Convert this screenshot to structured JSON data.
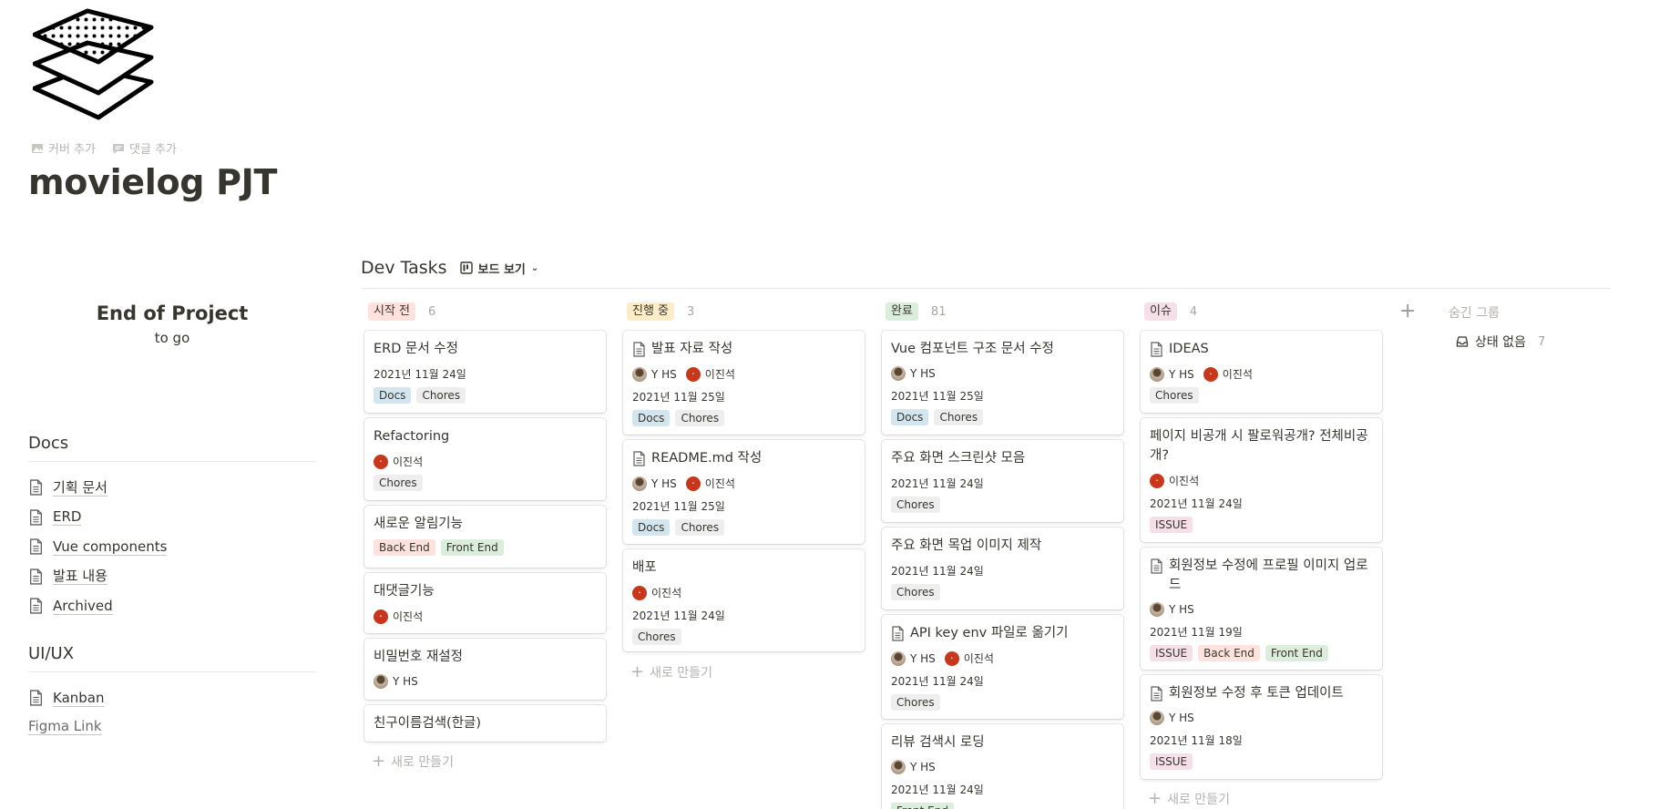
{
  "page": {
    "title": "movielog PJT",
    "actions": {
      "add_cover": "커버 추가",
      "add_comment": "댓글 추가"
    },
    "icon": "stack-layers-icon"
  },
  "countdown": {
    "title": "End of Project",
    "subtitle": "to go"
  },
  "sidebar": {
    "docs_heading": "Docs",
    "docs_links": [
      "기획 문서",
      "ERD",
      "Vue components",
      "발표 내용",
      "Archived"
    ],
    "uiux_heading": "UI/UX",
    "uiux_links": [
      "Kanban"
    ],
    "figma_link": "Figma Link"
  },
  "board": {
    "title": "Dev Tasks",
    "view_label": "보드 보기",
    "new_label": "새로 만들기",
    "hidden_groups_label": "숨긴 그룹",
    "no_status": {
      "label": "상태 없음",
      "count": "7"
    },
    "columns": [
      {
        "status": "시작 전",
        "count": "6",
        "pill_bg": "#ffe2dd",
        "cards": [
          {
            "title": "ERD 문서 수정",
            "date": "2021년 11월 24일",
            "tags": [
              "Docs",
              "Chores"
            ]
          },
          {
            "title": "Refactoring",
            "people": [
              "이진석"
            ],
            "tags": [
              "Chores"
            ]
          },
          {
            "title": "새로운 알림기능",
            "tags": [
              "Back End",
              "Front End"
            ]
          },
          {
            "title": "대댓글기능",
            "people": [
              "이진석"
            ]
          },
          {
            "title": "비밀번호 재설정",
            "people": [
              "Y HS"
            ]
          },
          {
            "title": "친구이름검색(한글)"
          }
        ]
      },
      {
        "status": "진행 중",
        "count": "3",
        "pill_bg": "#fdecc8",
        "cards": [
          {
            "title": "발표 자료 작성",
            "doc": true,
            "people": [
              "Y HS",
              "이진석"
            ],
            "date": "2021년 11월 25일",
            "tags": [
              "Docs",
              "Chores"
            ]
          },
          {
            "title": "README.md 작성",
            "doc": true,
            "people": [
              "Y HS",
              "이진석"
            ],
            "date": "2021년 11월 25일",
            "tags": [
              "Docs",
              "Chores"
            ]
          },
          {
            "title": "배포",
            "people": [
              "이진석"
            ],
            "date": "2021년 11월 24일",
            "tags": [
              "Chores"
            ]
          }
        ]
      },
      {
        "status": "완료",
        "count": "81",
        "pill_bg": "#dbeddb",
        "cards": [
          {
            "title": "Vue 컴포넌트 구조 문서 수정",
            "people": [
              "Y HS"
            ],
            "date": "2021년 11월 25일",
            "tags": [
              "Docs",
              "Chores"
            ]
          },
          {
            "title": "주요 화면 스크린샷 모음",
            "date": "2021년 11월 24일",
            "tags": [
              "Chores"
            ]
          },
          {
            "title": "주요 화면 목업 이미지 제작",
            "date": "2021년 11월 24일",
            "tags": [
              "Chores"
            ]
          },
          {
            "title": "API key env 파일로 옮기기",
            "doc": true,
            "people": [
              "Y HS",
              "이진석"
            ],
            "date": "2021년 11월 24일",
            "tags": [
              "Chores"
            ]
          },
          {
            "title": "리뷰 검색시 로딩",
            "people": [
              "Y HS"
            ],
            "date": "2021년 11월 24일",
            "tags": [
              "Front End"
            ]
          }
        ]
      },
      {
        "status": "이슈",
        "count": "4",
        "pill_bg": "#f5e0e9",
        "cards": [
          {
            "title": "IDEAS",
            "doc": true,
            "people": [
              "Y HS",
              "이진석"
            ],
            "tags": [
              "Chores"
            ]
          },
          {
            "title": "페이지 비공개 시 팔로워공개? 전체비공개?",
            "people": [
              "이진석"
            ],
            "date": "2021년 11월 24일",
            "tags": [
              "ISSUE"
            ]
          },
          {
            "title": "회원정보 수정에 프로필 이미지 업로드",
            "doc": true,
            "people": [
              "Y HS"
            ],
            "date": "2021년 11월 19일",
            "tags": [
              "ISSUE",
              "Back End",
              "Front End"
            ]
          },
          {
            "title": "회원정보 수정 후 토큰 업데이트",
            "doc": true,
            "people": [
              "Y HS"
            ],
            "date": "2021년 11월 18일",
            "tags": [
              "ISSUE"
            ]
          }
        ]
      }
    ]
  },
  "colors": {
    "text": "#37352f",
    "muted": "#b4b2ae",
    "docs": "#d3e5ef",
    "chores": "#eeeeee",
    "back_end": "#ffe2dd",
    "front_end": "#dbeddb",
    "issue": "#f5e0e9",
    "avatar_lee": "#c8361b"
  }
}
